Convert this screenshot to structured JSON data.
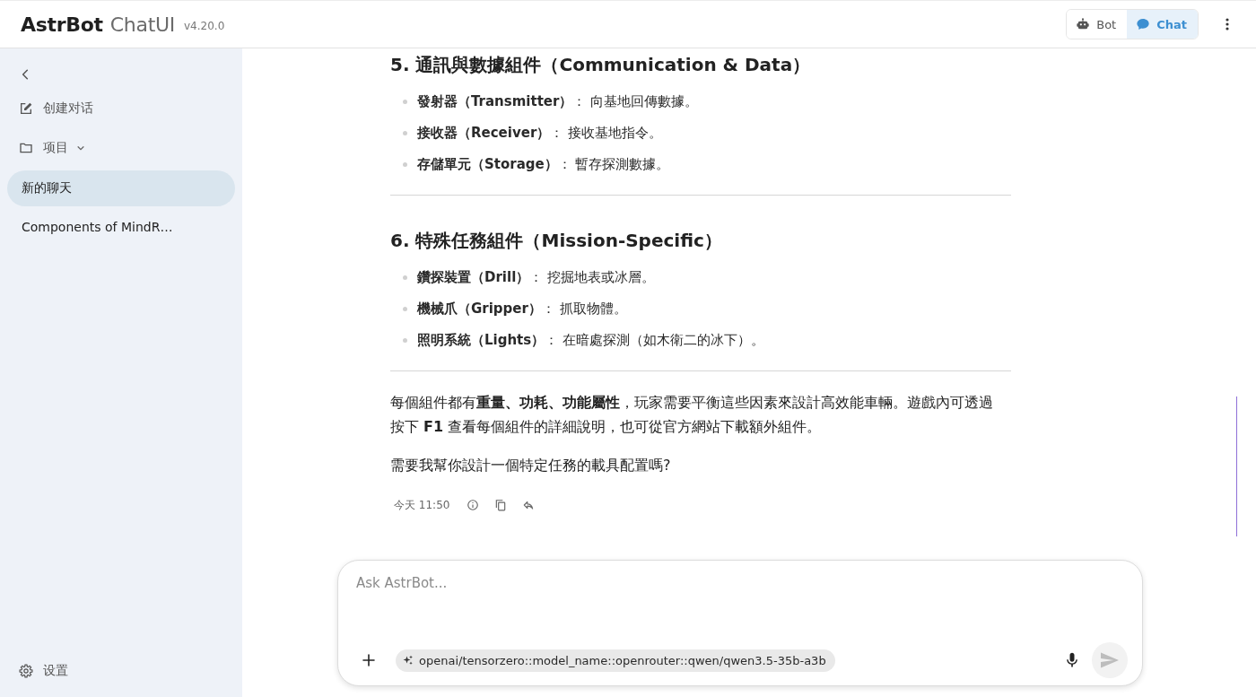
{
  "header": {
    "brand": "AstrBot",
    "product": "ChatUI",
    "version": "v4.20.0",
    "mode_toggle": [
      {
        "label": "Bot",
        "selected": false
      },
      {
        "label": "Chat",
        "selected": true
      }
    ]
  },
  "sidebar": {
    "items": [
      {
        "kind": "new",
        "label": "创建对话"
      },
      {
        "kind": "folder",
        "label": "项目"
      }
    ],
    "conversations": [
      {
        "title": "新的聊天",
        "selected": true
      },
      {
        "title": "Components of MindR…",
        "selected": false
      }
    ],
    "settings": "设置"
  },
  "message": {
    "blocks": [
      {
        "kind": "heading",
        "text": "5. 通訊與數據組件（Communication & Data）"
      },
      {
        "kind": "list",
        "items": [
          "**發射器（Transmitter）**： 向基地回傳數據。",
          "**接收器（Receiver）**： 接收基地指令。",
          "**存儲單元（Storage）**： 暫存探測數據。"
        ]
      },
      {
        "kind": "rule"
      },
      {
        "kind": "heading",
        "text": "6. 特殊任務組件（Mission-Specific）"
      },
      {
        "kind": "list",
        "items": [
          "**鑽探裝置（Drill）**： 挖掘地表或冰層。",
          "**機械爪（Gripper）**： 抓取物體。",
          "**照明系統（Lights）**： 在暗處探測（如木衛二的冰下）。"
        ]
      },
      {
        "kind": "rule"
      },
      {
        "kind": "paragraph",
        "text": "每個組件都有**重量、功耗、功能屬性**，玩家需要平衡這些因素來設計高效能車輛。遊戲內可透過按下 **F1** 查看每個組件的詳細說明，也可從官方網站下載額外組件。"
      },
      {
        "kind": "paragraph",
        "text": "需要我幫你設計一個特定任務的載具配置嗎?"
      }
    ],
    "time": "今天 11:50"
  },
  "composer": {
    "placeholder": "Ask AstrBot...",
    "model": "openai/tensorzero::model_name::openrouter::qwen/qwen3.5-35b-a3b"
  }
}
